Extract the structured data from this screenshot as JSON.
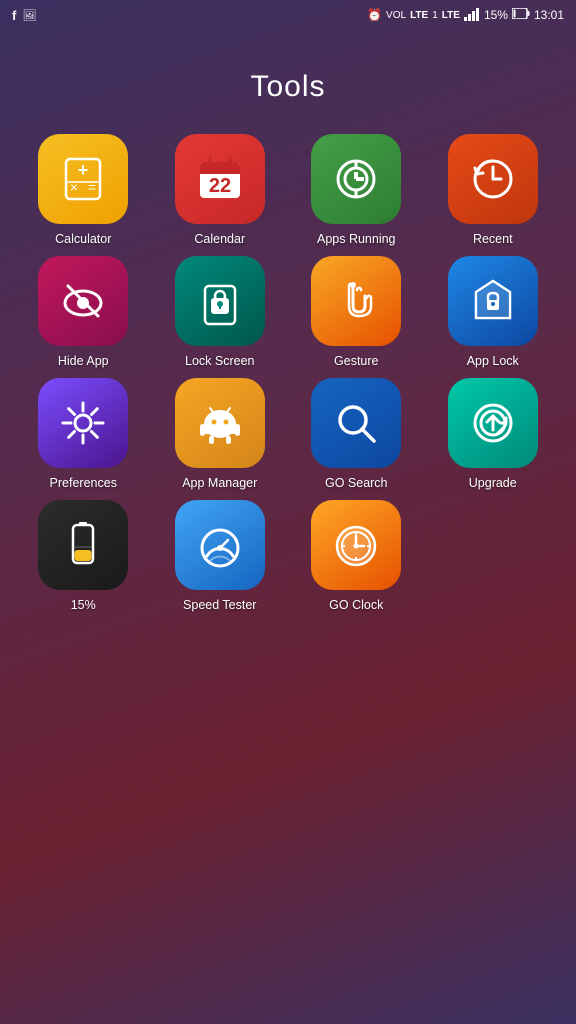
{
  "status": {
    "alarm": "⏰",
    "vol": "VOL",
    "lte": "LTE",
    "sim": "1",
    "signal": "📶",
    "battery_percent": "15%",
    "time": "13:01"
  },
  "page": {
    "title": "Tools"
  },
  "apps": [
    {
      "id": "calculator",
      "label": "Calculator",
      "bg": "bg-calculator"
    },
    {
      "id": "calendar",
      "label": "Calendar",
      "bg": "bg-calendar"
    },
    {
      "id": "apps-running",
      "label": "Apps Running",
      "bg": "bg-apps-running"
    },
    {
      "id": "recent",
      "label": "Recent",
      "bg": "bg-recent"
    },
    {
      "id": "hide-app",
      "label": "Hide App",
      "bg": "bg-hide-app"
    },
    {
      "id": "lock-screen",
      "label": "Lock Screen",
      "bg": "bg-lock-screen"
    },
    {
      "id": "gesture",
      "label": "Gesture",
      "bg": "bg-gesture"
    },
    {
      "id": "app-lock",
      "label": "App Lock",
      "bg": "bg-app-lock"
    },
    {
      "id": "preferences",
      "label": "Preferences",
      "bg": "bg-preferences"
    },
    {
      "id": "app-manager",
      "label": "App Manager",
      "bg": "bg-app-manager"
    },
    {
      "id": "go-search",
      "label": "GO Search",
      "bg": "bg-go-search"
    },
    {
      "id": "upgrade",
      "label": "Upgrade",
      "bg": "bg-upgrade"
    },
    {
      "id": "15percent",
      "label": "15%",
      "bg": "bg-15percent"
    },
    {
      "id": "speed-tester",
      "label": "Speed Tester",
      "bg": "bg-speed-tester"
    },
    {
      "id": "go-clock",
      "label": "GO Clock",
      "bg": "bg-go-clock"
    }
  ]
}
